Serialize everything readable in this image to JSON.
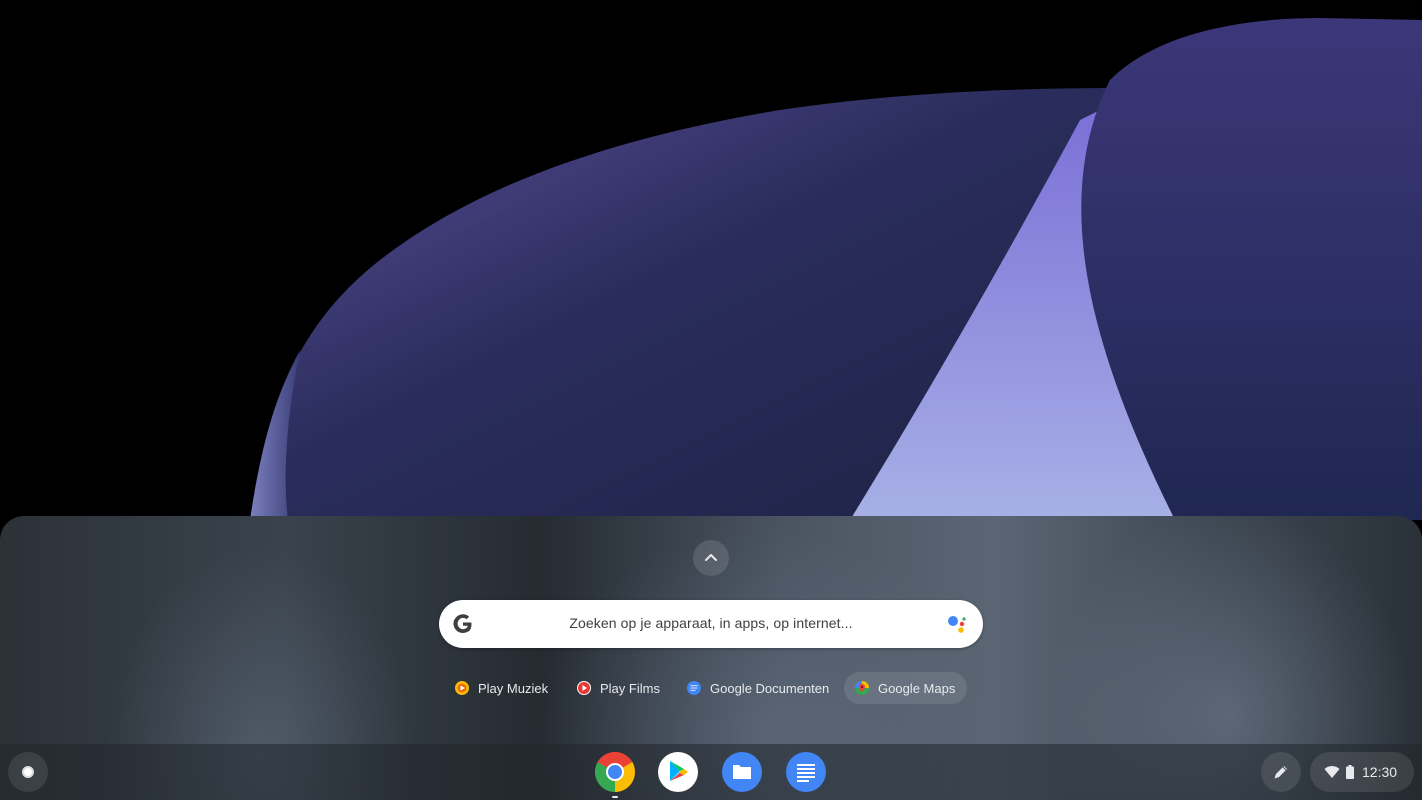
{
  "launcher": {
    "expand_icon": "chevron-up-icon",
    "search": {
      "placeholder": "Zoeken op je apparaat, in apps, op internet...",
      "left_icon": "google-g-icon",
      "right_icon": "google-assistant-icon"
    },
    "suggestions": [
      {
        "label": "Play Muziek",
        "icon": "play-music-icon"
      },
      {
        "label": "Play Films",
        "icon": "play-movies-icon"
      },
      {
        "label": "Google Documenten",
        "icon": "google-docs-icon"
      },
      {
        "label": "Google Maps",
        "icon": "google-maps-icon"
      }
    ]
  },
  "shelf": {
    "launcher_icon": "launcher-circle-icon",
    "pinned_apps": [
      {
        "name": "Chrome",
        "icon": "chrome-icon",
        "running": true
      },
      {
        "name": "Play Store",
        "icon": "play-store-icon",
        "running": false
      },
      {
        "name": "Files",
        "icon": "files-icon",
        "running": false
      },
      {
        "name": "Docs",
        "icon": "docs-icon",
        "running": false
      }
    ],
    "stylus_icon": "stylus-icon",
    "status": {
      "wifi_icon": "wifi-icon",
      "battery_icon": "battery-icon",
      "time": "12:30"
    }
  },
  "colors": {
    "google_blue": "#4285f4",
    "google_red": "#ea4335",
    "google_yellow": "#fbbc04",
    "google_green": "#34a853",
    "wallpaper_purple": "#5a4a9a"
  }
}
